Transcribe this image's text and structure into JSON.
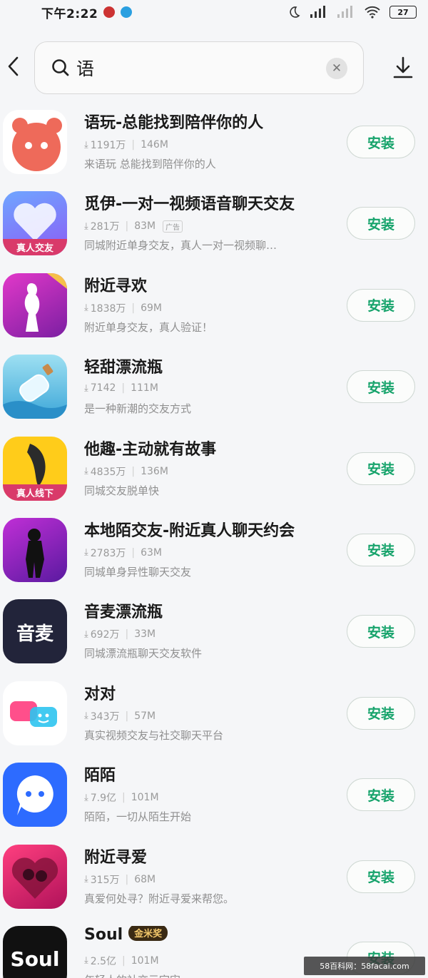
{
  "status_bar": {
    "time": "下午2:22",
    "battery": "27"
  },
  "search": {
    "query": "语"
  },
  "apps": [
    {
      "name": "语玩-总能找到陪伴你的人",
      "downloads": "1191万",
      "size": "146M",
      "desc": "来语玩 总能找到陪伴你的人",
      "install": "安装"
    },
    {
      "name": "觅伊-一对一视频语音聊天交友",
      "downloads": "281万",
      "size": "83M",
      "ad": "广告",
      "desc": "同城附近单身交友，真人一对一视频聊…",
      "install": "安装",
      "icon_label": "真人交友"
    },
    {
      "name": "附近寻欢",
      "downloads": "1838万",
      "size": "69M",
      "desc": "附近单身交友，真人验证！",
      "install": "安装"
    },
    {
      "name": "轻甜漂流瓶",
      "downloads": "7142",
      "size": "111M",
      "desc": "是一种新潮的交友方式",
      "install": "安装"
    },
    {
      "name": "他趣-主动就有故事",
      "downloads": "4835万",
      "size": "136M",
      "desc": "同城交友脱单快",
      "install": "安装",
      "icon_label": "真人线下"
    },
    {
      "name": "本地陌交友-附近真人聊天约会",
      "downloads": "2783万",
      "size": "63M",
      "desc": "同城单身异性聊天交友",
      "install": "安装"
    },
    {
      "name": "音麦漂流瓶",
      "downloads": "692万",
      "size": "33M",
      "desc": "同城漂流瓶聊天交友软件",
      "install": "安装",
      "icon_label": "音麦"
    },
    {
      "name": "对对",
      "downloads": "343万",
      "size": "57M",
      "desc": "真实视频交友与社交聊天平台",
      "install": "安装"
    },
    {
      "name": "陌陌",
      "downloads": "7.9亿",
      "size": "101M",
      "desc": "陌陌，一切从陌生开始",
      "install": "安装"
    },
    {
      "name": "附近寻爱",
      "downloads": "315万",
      "size": "68M",
      "desc": "真爱何处寻？附近寻爱来帮您。",
      "install": "安装"
    },
    {
      "name": "Soul",
      "badge": "金米奖",
      "downloads": "2.5亿",
      "size": "101M",
      "desc": "年轻人的社交元宇宙",
      "install": "安装",
      "icon_label": "Soul"
    }
  ],
  "watermark": "58百科网：58facai.com",
  "colors": {
    "install_green": "#16a36b",
    "background": "#f5f6f8"
  }
}
